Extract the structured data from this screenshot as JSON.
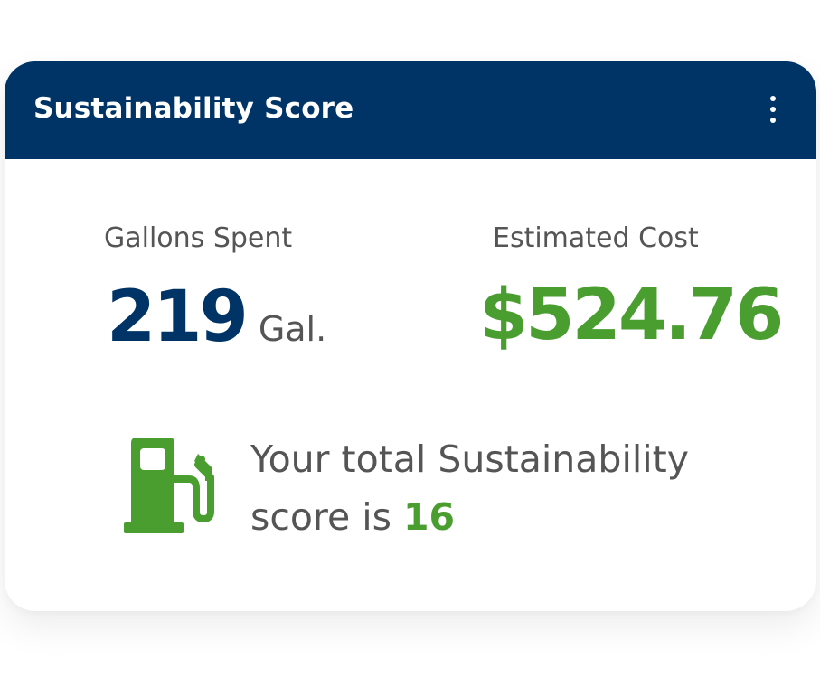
{
  "card": {
    "title": "Sustainability Score",
    "menu_icon": "more-vertical-icon"
  },
  "gallons": {
    "label": "Gallons Spent",
    "value": "219",
    "unit": "Gal."
  },
  "cost": {
    "label": "Estimated Cost",
    "value": "$524.76"
  },
  "score": {
    "icon": "fuel-pump-icon",
    "text_before": "Your total Sustainability score is",
    "value": "16"
  },
  "colors": {
    "header_bg": "#003366",
    "accent_green": "#4a9e2f",
    "text_gray": "#555555"
  }
}
